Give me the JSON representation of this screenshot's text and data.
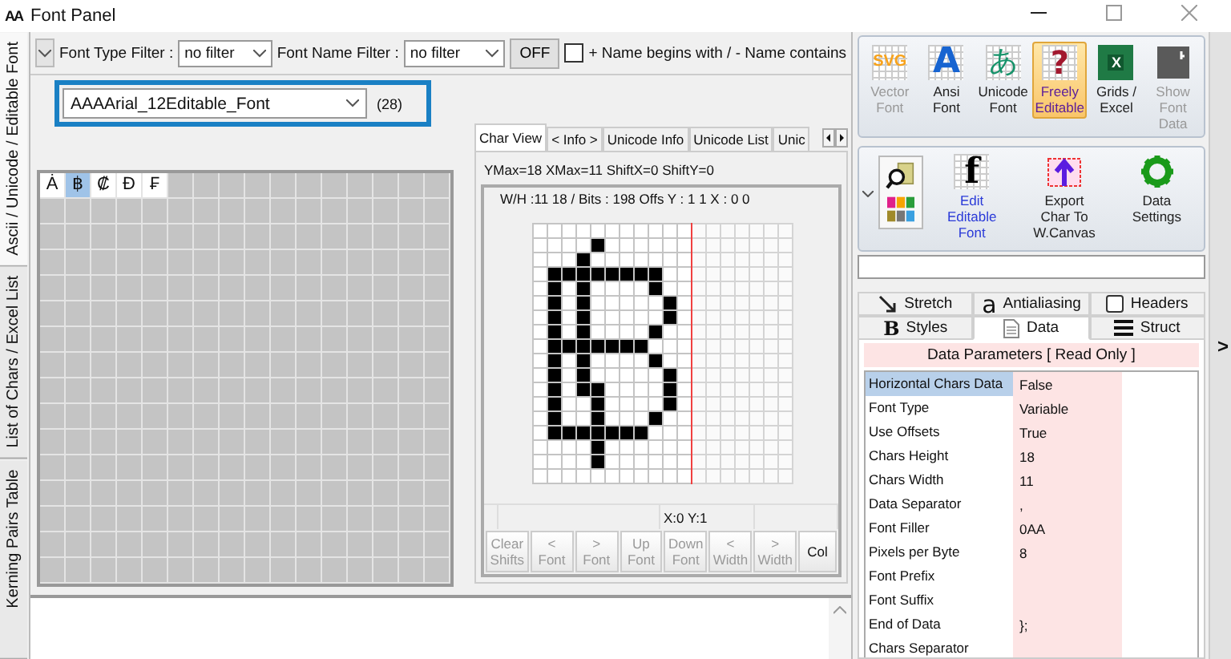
{
  "window": {
    "icon_text": "AA",
    "title": "Font Panel"
  },
  "side_tabs": [
    {
      "label": "Ascii / Unicode / Editable Font",
      "selected": true
    },
    {
      "label": "List of Chars  / Excel List",
      "selected": false
    },
    {
      "label": "Kerning Pairs Table",
      "selected": false
    }
  ],
  "filter_bar": {
    "font_type_label": "Font Type Filter :",
    "font_type_value": "no filter",
    "font_name_label": "Font Name Filter :",
    "font_name_value": "no filter",
    "toggle_button": "OFF",
    "name_mode": {
      "label": "+ Name begins with / - Name contains",
      "checked": false
    }
  },
  "font_selector": {
    "value": "AAAArial_12Editable_Font",
    "count": "(28)"
  },
  "char_grid": {
    "cells": [
      {
        "char": "Ȧ",
        "selected": false
      },
      {
        "char": "฿",
        "selected": true
      },
      {
        "char": "₡",
        "selected": false
      },
      {
        "char": "Ɖ",
        "selected": false
      },
      {
        "char": "₣",
        "selected": false
      }
    ]
  },
  "char_view": {
    "tabs": [
      {
        "label": "Char View",
        "selected": true
      },
      {
        "label": "< Info >",
        "selected": false
      },
      {
        "label": "Unicode Info",
        "selected": false
      },
      {
        "label": "Unicode List",
        "selected": false
      },
      {
        "label": "Unic",
        "selected": false
      }
    ],
    "info": "YMax=18  XMax=11  ShiftX=0  ShiftY=0",
    "frame_info": "W/H :11  18 / Bits : 198  Offs Y : 1 1  X : 0 0",
    "bitmap": [
      [
        false,
        false,
        false,
        false,
        false,
        false,
        false,
        false,
        false,
        false,
        false
      ],
      [
        false,
        false,
        false,
        false,
        true,
        false,
        false,
        false,
        false,
        false,
        false
      ],
      [
        false,
        false,
        false,
        true,
        false,
        false,
        false,
        false,
        false,
        false,
        false
      ],
      [
        false,
        true,
        true,
        true,
        true,
        true,
        true,
        true,
        true,
        false,
        false
      ],
      [
        false,
        true,
        false,
        true,
        false,
        false,
        false,
        false,
        true,
        false,
        false
      ],
      [
        false,
        true,
        false,
        true,
        false,
        false,
        false,
        false,
        false,
        true,
        false
      ],
      [
        false,
        true,
        false,
        true,
        false,
        false,
        false,
        false,
        false,
        true,
        false
      ],
      [
        false,
        true,
        false,
        true,
        false,
        false,
        false,
        false,
        true,
        false,
        false
      ],
      [
        false,
        true,
        true,
        true,
        true,
        true,
        true,
        true,
        false,
        false,
        false
      ],
      [
        false,
        true,
        false,
        true,
        false,
        false,
        false,
        false,
        true,
        false,
        false
      ],
      [
        false,
        true,
        false,
        true,
        false,
        false,
        false,
        false,
        false,
        true,
        false
      ],
      [
        false,
        true,
        false,
        true,
        true,
        false,
        false,
        false,
        false,
        true,
        false
      ],
      [
        false,
        true,
        false,
        false,
        true,
        false,
        false,
        false,
        false,
        true,
        false
      ],
      [
        false,
        true,
        false,
        false,
        true,
        false,
        false,
        false,
        true,
        false,
        false
      ],
      [
        false,
        true,
        true,
        true,
        true,
        true,
        true,
        true,
        false,
        false,
        false
      ],
      [
        false,
        false,
        false,
        false,
        true,
        false,
        false,
        false,
        false,
        false,
        false
      ],
      [
        false,
        false,
        false,
        false,
        true,
        false,
        false,
        false,
        false,
        false,
        false
      ],
      [
        false,
        false,
        false,
        false,
        false,
        false,
        false,
        false,
        false,
        false,
        false
      ]
    ],
    "status": "X:0 Y:1",
    "buttons": [
      {
        "lines": [
          "Clear",
          "Shifts"
        ],
        "disabled": true
      },
      {
        "lines": [
          "<",
          "Font"
        ],
        "disabled": true
      },
      {
        "lines": [
          ">",
          "Font"
        ],
        "disabled": true
      },
      {
        "lines": [
          "Up",
          "Font"
        ],
        "disabled": true
      },
      {
        "lines": [
          "Down",
          "Font"
        ],
        "disabled": true
      },
      {
        "lines": [
          "<",
          "Width"
        ],
        "disabled": true
      },
      {
        "lines": [
          ">",
          "Width"
        ],
        "disabled": true
      },
      {
        "lines": [
          "Col"
        ],
        "disabled": false
      }
    ]
  },
  "ribbon": {
    "main_buttons": [
      {
        "kind": "svg",
        "glyph": "SVG",
        "lines": [
          "Vector",
          "Font"
        ],
        "disabled": true,
        "selected": false
      },
      {
        "kind": "letter",
        "glyph": "A",
        "lines": [
          "Ansi",
          "Font"
        ],
        "disabled": false,
        "selected": false
      },
      {
        "kind": "kana",
        "glyph": "あ",
        "lines": [
          "Unicode",
          "Font"
        ],
        "disabled": false,
        "selected": false
      },
      {
        "kind": "question",
        "glyph": "?",
        "lines": [
          "Freely",
          "Editable"
        ],
        "disabled": false,
        "selected": true
      },
      {
        "kind": "excel",
        "glyph": "X",
        "lines": [
          "Grids /",
          "Excel"
        ],
        "disabled": false,
        "selected": false
      },
      {
        "kind": "dark",
        "lines": [
          "Show",
          "Font",
          "Data"
        ],
        "disabled": true,
        "selected": false
      }
    ],
    "tools": [
      {
        "kind": "f",
        "glyph": "f",
        "lines": [
          "Edit",
          "Editable",
          "Font"
        ],
        "highlighted": true
      },
      {
        "kind": "export",
        "lines": [
          "Export",
          "Char To",
          "W.Canvas"
        ],
        "highlighted": false
      },
      {
        "kind": "gear",
        "lines": [
          "Data",
          "Settings"
        ],
        "highlighted": false
      }
    ]
  },
  "settings_tabs": [
    [
      {
        "kind": "stretch",
        "label": "Stretch",
        "selected": false
      },
      {
        "kind": "glyph",
        "glyph": "a",
        "label": "Antialiasing",
        "selected": false
      },
      {
        "kind": "box",
        "label": "Headers",
        "selected": false
      }
    ],
    [
      {
        "kind": "bold",
        "glyph": "B",
        "label": "Styles",
        "selected": false
      },
      {
        "kind": "doc",
        "label": "Data",
        "selected": true
      },
      {
        "kind": "lines",
        "label": "Struct",
        "selected": false
      }
    ]
  ],
  "data_parameters": {
    "title": "Data Parameters [ Read Only ]",
    "rows": [
      {
        "name": "Horizontal Chars Data",
        "value": "False",
        "selected": true
      },
      {
        "name": "Font Type",
        "value": "Variable",
        "selected": false
      },
      {
        "name": "Use Offsets",
        "value": "True",
        "selected": false
      },
      {
        "name": "Chars Height",
        "value": "18",
        "selected": false
      },
      {
        "name": "Chars Width",
        "value": "11",
        "selected": false
      },
      {
        "name": "Data Separator",
        "value": ",",
        "selected": false
      },
      {
        "name": "Font Filler",
        "value": "0AA",
        "selected": false
      },
      {
        "name": "Pixels per Byte",
        "value": "8",
        "selected": false
      },
      {
        "name": "Font Prefix",
        "selected": false
      },
      {
        "name": "Font Suffix",
        "selected": false
      },
      {
        "name": "End of Data",
        "value": "};",
        "selected": false
      },
      {
        "name": "Chars Separator",
        "selected": false
      }
    ]
  },
  "expand_button": ">"
}
